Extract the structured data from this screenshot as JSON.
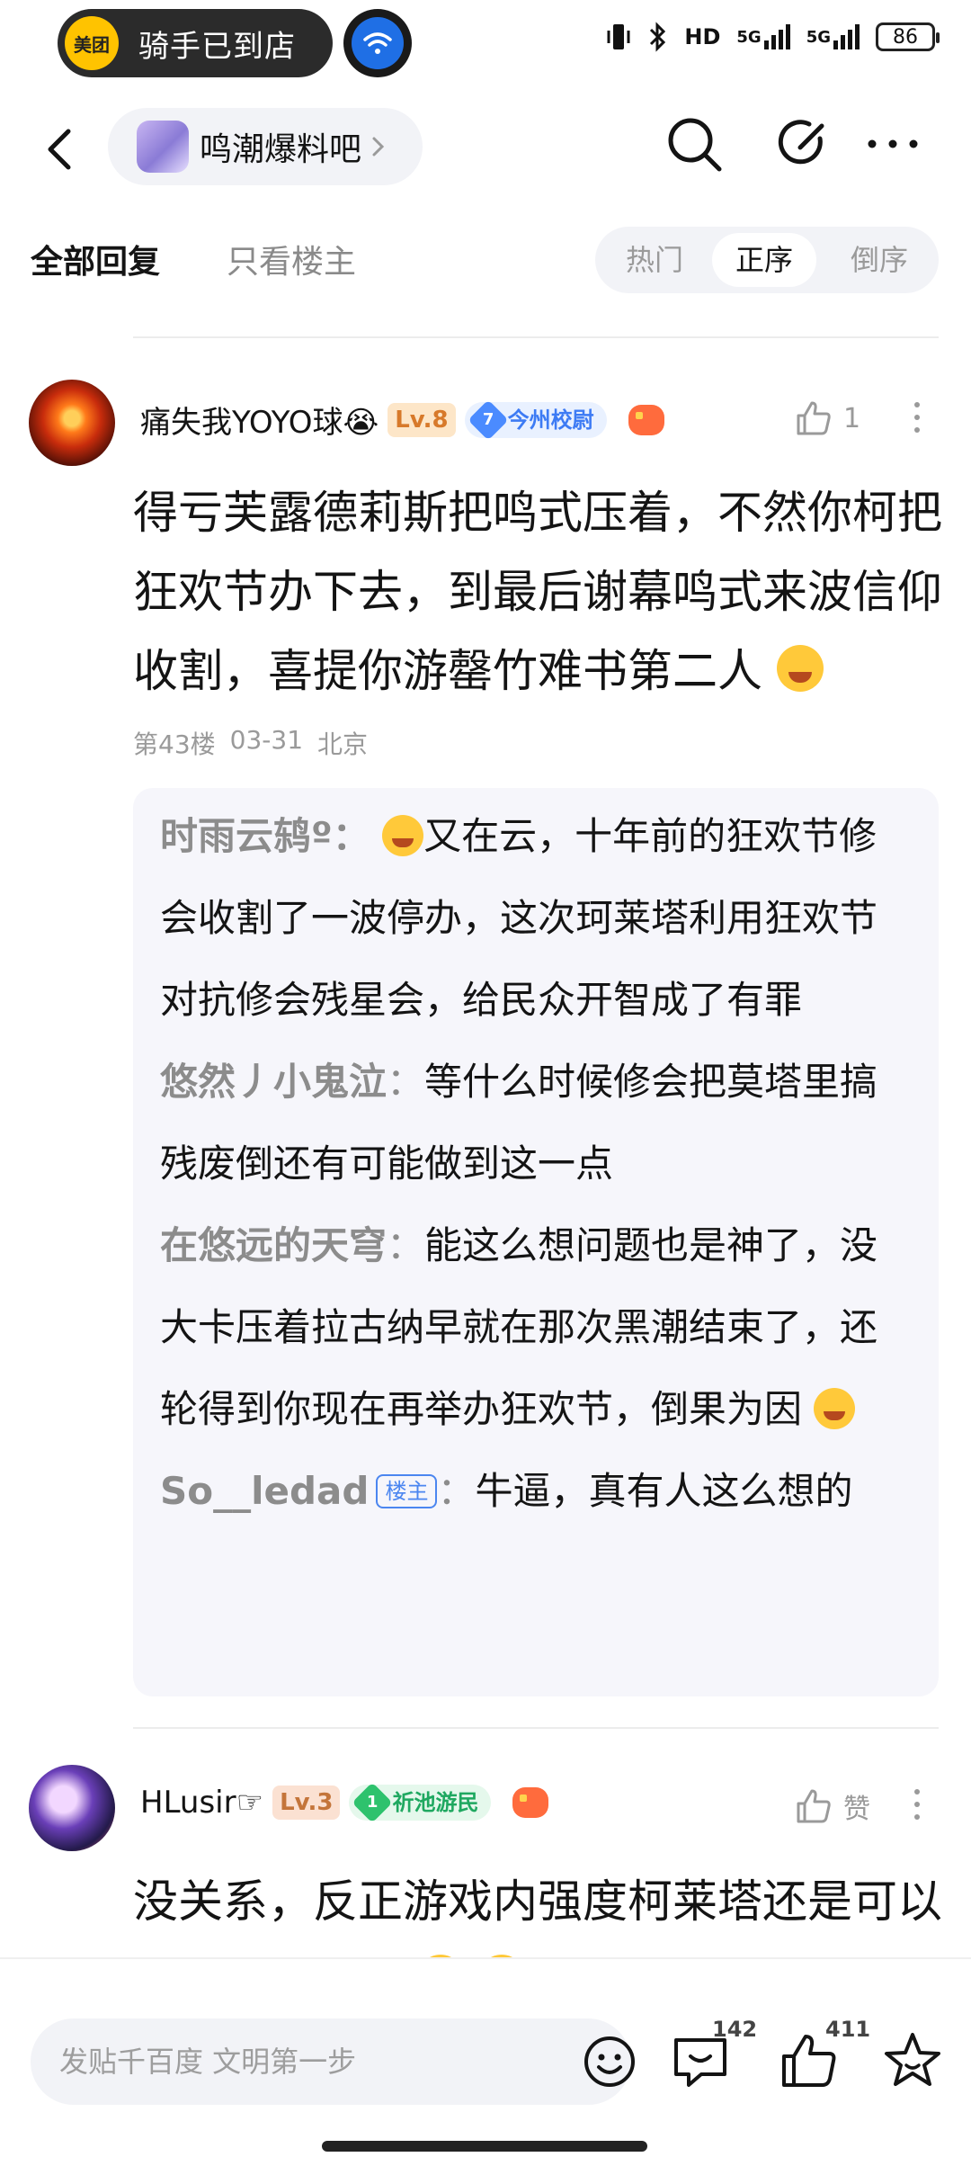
{
  "status_bar": {
    "delivery_brand": "美团",
    "delivery_status": "骑手已到店",
    "network_badges": [
      "HD",
      "5G",
      "5G"
    ],
    "battery": "86"
  },
  "header": {
    "forum_name": "鸣潮爆料吧"
  },
  "tabs": {
    "all_replies": "全部回复",
    "owner_only": "只看楼主",
    "sort_options": [
      "热门",
      "正序",
      "倒序"
    ],
    "selected_sort": "正序"
  },
  "posts": [
    {
      "username": "痛失我YOYO球😭",
      "level": "Lv.8",
      "title_level": "7",
      "title": "今州校尉",
      "likes": "1",
      "body": "得亏芙露德莉斯把鸣式压着，不然你柯把狂欢节办下去，到最后谢幕鸣式来波信仰收割，喜提你游罄竹难书第二人",
      "floor": "第43楼",
      "date": "03-31",
      "location": "北京",
      "replies": [
        {
          "name": "时雨云鸫º",
          "text": "又在云，十年前的狂欢节修会收割了一波停办，这次珂莱塔利用狂欢节对抗修会残星会，给民众开智成了有罪"
        },
        {
          "name": "悠然丿小鬼泣",
          "text": "等什么时候修会把莫塔里搞残废倒还有可能做到这一点"
        },
        {
          "name": "在悠远的天穹",
          "text": "能这么想问题也是神了，没大卡压着拉古纳早就在那次黑潮结束了，还轮得到你现在再举办狂欢节，倒果为因"
        },
        {
          "name": "So__ledad",
          "tag": "楼主",
          "text": "牛逼，真有人这么想的"
        }
      ]
    },
    {
      "username": "HLusir☞",
      "level": "Lv.3",
      "title_level": "1",
      "title": "祈池游民",
      "likes": "赞",
      "body": "没关系，反正游戏内强度柯莱塔还是可以踩头一票角色"
    }
  ],
  "bottom_bar": {
    "input_placeholder": "发贴千百度 文明第一步",
    "comment_count": "142",
    "like_count": "411"
  },
  "icons": [
    "back-icon",
    "chevron-right-icon",
    "search-icon",
    "edit-icon",
    "more-icon",
    "thumbs-up-icon",
    "kebab-icon",
    "emoji-icon",
    "comment-icon",
    "star-icon",
    "wifi-icon",
    "bluetooth-icon",
    "vibrate-icon"
  ],
  "colors": {
    "accent": "#3d7bf4",
    "level_badge": "#d7792a",
    "muted": "#9a9a9a"
  }
}
